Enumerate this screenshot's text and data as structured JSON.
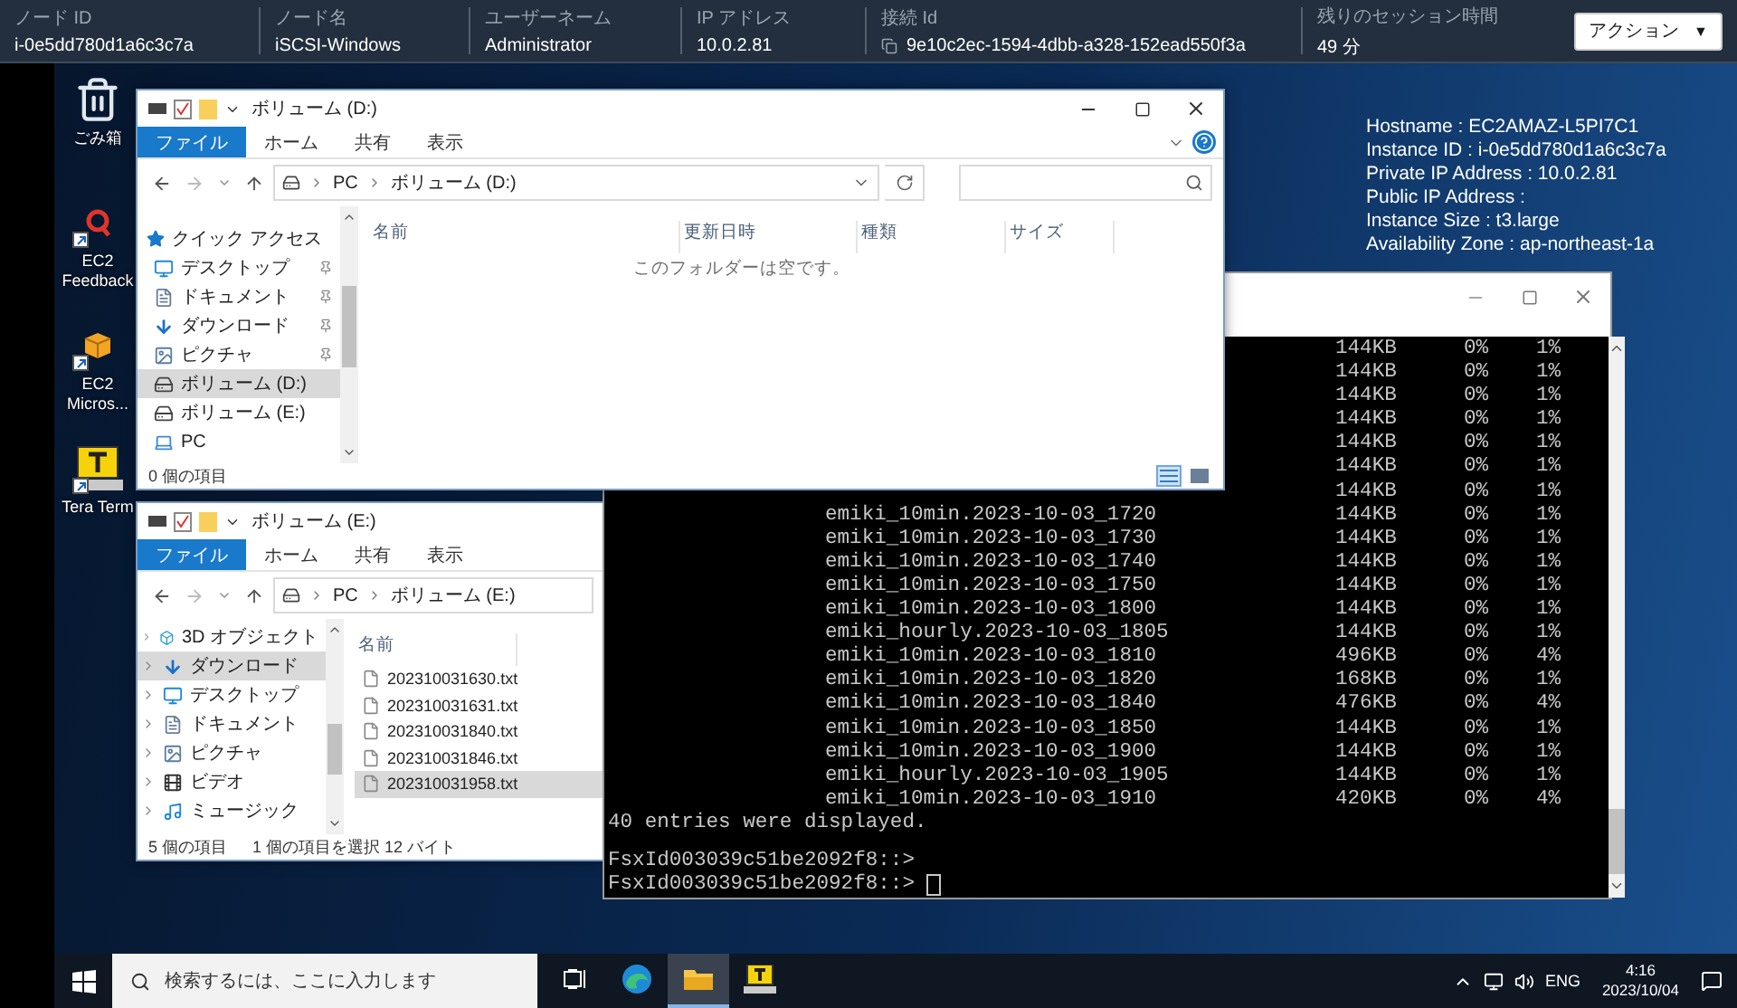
{
  "session_bar": {
    "fields": [
      {
        "label": "ノード ID",
        "value": "i-0e5dd780d1a6c3c7a",
        "copyable": false
      },
      {
        "label": "ノード名",
        "value": "iSCSI-Windows",
        "copyable": false
      },
      {
        "label": "ユーザーネーム",
        "value": "Administrator",
        "copyable": false
      },
      {
        "label": "IP アドレス",
        "value": "10.0.2.81",
        "copyable": false
      },
      {
        "label": "接続 Id",
        "value": "9e10c2ec-1594-4dbb-a328-152ead550f3a",
        "copyable": true
      },
      {
        "label": "残りのセッション時間",
        "value": "49 分",
        "copyable": false
      }
    ],
    "action_button": {
      "label": "アクション",
      "caret": "▼"
    }
  },
  "desktop": {
    "icons": [
      {
        "label": "ごみ箱",
        "kind": "recycle",
        "shortcut": false
      },
      {
        "label": "EC2 Feedback",
        "kind": "feedback",
        "shortcut": true
      },
      {
        "label": "EC2 Micros...",
        "kind": "package",
        "shortcut": true
      },
      {
        "label": "Tera Term",
        "kind": "terminal",
        "shortcut": true
      }
    ],
    "info_lines": [
      "Hostname : EC2AMAZ-L5PI7C1",
      "Instance ID : i-0e5dd780d1a6c3c7a",
      "Private IP Address : 10.0.2.81",
      "Public IP Address :",
      "Instance Size : t3.large",
      "Availability Zone : ap-northeast-1a"
    ]
  },
  "explorer_windows": [
    {
      "title": "ボリューム (D:)",
      "ribbon_tabs": [
        {
          "label": "ファイル",
          "selected": true
        },
        {
          "label": "ホーム",
          "selected": false
        },
        {
          "label": "共有",
          "selected": false
        },
        {
          "label": "表示",
          "selected": false
        }
      ],
      "path": [
        "PC",
        "ボリューム (D:)"
      ],
      "nav": [
        {
          "label": "クイック アクセス",
          "kind": "star",
          "pinned": false,
          "selected": false
        },
        {
          "label": "デスクトップ",
          "kind": "desktop",
          "pinned": true,
          "selected": false
        },
        {
          "label": "ドキュメント",
          "kind": "document",
          "pinned": true,
          "selected": false
        },
        {
          "label": "ダウンロード",
          "kind": "download",
          "pinned": true,
          "selected": false
        },
        {
          "label": "ピクチャ",
          "kind": "picture",
          "pinned": true,
          "selected": false
        },
        {
          "label": "ボリューム (D:)",
          "kind": "drive",
          "pinned": false,
          "selected": true
        },
        {
          "label": "ボリューム (E:)",
          "kind": "drive",
          "pinned": false,
          "selected": false
        },
        {
          "label": "PC",
          "kind": "pc",
          "pinned": false,
          "selected": false
        }
      ],
      "columns": [
        "名前",
        "更新日時",
        "種類",
        "サイズ"
      ],
      "empty_message": "このフォルダーは空です。",
      "status": [
        "0 個の項目"
      ]
    },
    {
      "title": "ボリューム (E:)",
      "ribbon_tabs": [
        {
          "label": "ファイル",
          "selected": true
        },
        {
          "label": "ホーム",
          "selected": false
        },
        {
          "label": "共有",
          "selected": false
        },
        {
          "label": "表示",
          "selected": false
        }
      ],
      "path": [
        "PC",
        "ボリューム (E:)"
      ],
      "nav": [
        {
          "label": "3D オブジェクト",
          "kind": "cube",
          "expandable": true,
          "selected": false
        },
        {
          "label": "ダウンロード",
          "kind": "download",
          "expandable": true,
          "selected": true
        },
        {
          "label": "デスクトップ",
          "kind": "desktop",
          "expandable": true,
          "selected": false
        },
        {
          "label": "ドキュメント",
          "kind": "document",
          "expandable": true,
          "selected": false
        },
        {
          "label": "ピクチャ",
          "kind": "picture",
          "expandable": true,
          "selected": false
        },
        {
          "label": "ビデオ",
          "kind": "video",
          "expandable": true,
          "selected": false
        },
        {
          "label": "ミュージック",
          "kind": "music",
          "expandable": true,
          "selected": false
        }
      ],
      "columns": [
        "名前"
      ],
      "files": [
        {
          "name": "202310031630.txt",
          "selected": false
        },
        {
          "name": "202310031631.txt",
          "selected": false
        },
        {
          "name": "202310031840.txt",
          "selected": false
        },
        {
          "name": "202310031846.txt",
          "selected": false
        },
        {
          "name": "202310031958.txt",
          "selected": true
        }
      ],
      "status": [
        "5 個の項目",
        "1 個の項目を選択 12 バイト"
      ]
    }
  ],
  "terminal": {
    "rows": [
      {
        "size": "144KB",
        "col_3": "0%",
        "col_4": "1%"
      },
      {
        "size": "144KB",
        "col_3": "0%",
        "col_4": "1%"
      },
      {
        "size": "144KB",
        "col_3": "0%",
        "col_4": "1%"
      },
      {
        "size": "144KB",
        "col_3": "0%",
        "col_4": "1%"
      },
      {
        "size": "144KB",
        "col_3": "0%",
        "col_4": "1%"
      },
      {
        "size": "144KB",
        "col_3": "0%",
        "col_4": "1%"
      },
      {
        "size": "144KB",
        "col_3": "0%",
        "col_4": "1%"
      },
      {
        "name": "emiki_10min.2023-10-03_1720",
        "size": "144KB",
        "col_3": "0%",
        "col_4": "1%"
      },
      {
        "name": "emiki_10min.2023-10-03_1730",
        "size": "144KB",
        "col_3": "0%",
        "col_4": "1%"
      },
      {
        "name": "emiki_10min.2023-10-03_1740",
        "size": "144KB",
        "col_3": "0%",
        "col_4": "1%"
      },
      {
        "name": "emiki_10min.2023-10-03_1750",
        "size": "144KB",
        "col_3": "0%",
        "col_4": "1%"
      },
      {
        "name": "emiki_10min.2023-10-03_1800",
        "size": "144KB",
        "col_3": "0%",
        "col_4": "1%"
      },
      {
        "name": "emiki_hourly.2023-10-03_1805",
        "size": "144KB",
        "col_3": "0%",
        "col_4": "1%"
      },
      {
        "name": "emiki_10min.2023-10-03_1810",
        "size": "496KB",
        "col_3": "0%",
        "col_4": "4%"
      },
      {
        "name": "emiki_10min.2023-10-03_1820",
        "size": "168KB",
        "col_3": "0%",
        "col_4": "1%"
      },
      {
        "name": "emiki_10min.2023-10-03_1840",
        "size": "476KB",
        "col_3": "0%",
        "col_4": "4%"
      },
      {
        "name": "emiki_10min.2023-10-03_1850",
        "size": "144KB",
        "col_3": "0%",
        "col_4": "1%"
      },
      {
        "name": "emiki_10min.2023-10-03_1900",
        "size": "144KB",
        "col_3": "0%",
        "col_4": "1%"
      },
      {
        "name": "emiki_hourly.2023-10-03_1905",
        "size": "144KB",
        "col_3": "0%",
        "col_4": "1%"
      },
      {
        "name": "emiki_10min.2023-10-03_1910",
        "size": "420KB",
        "col_3": "0%",
        "col_4": "4%"
      }
    ],
    "summary": "40 entries were displayed.",
    "prompts": [
      {
        "text": "FsxId003039c51be2092f8::>",
        "cursor": false
      },
      {
        "text": "FsxId003039c51be2092f8::>",
        "cursor": true
      }
    ]
  },
  "taskbar": {
    "search_placeholder": "検索するには、ここに入力します",
    "apps": [
      {
        "kind": "task_view",
        "active": false
      },
      {
        "kind": "edge",
        "active": false
      },
      {
        "kind": "explorer",
        "active": true
      },
      {
        "kind": "teraterm",
        "active": false
      }
    ],
    "language": "ENG",
    "time": "4:16",
    "date": "2023/10/04"
  }
}
